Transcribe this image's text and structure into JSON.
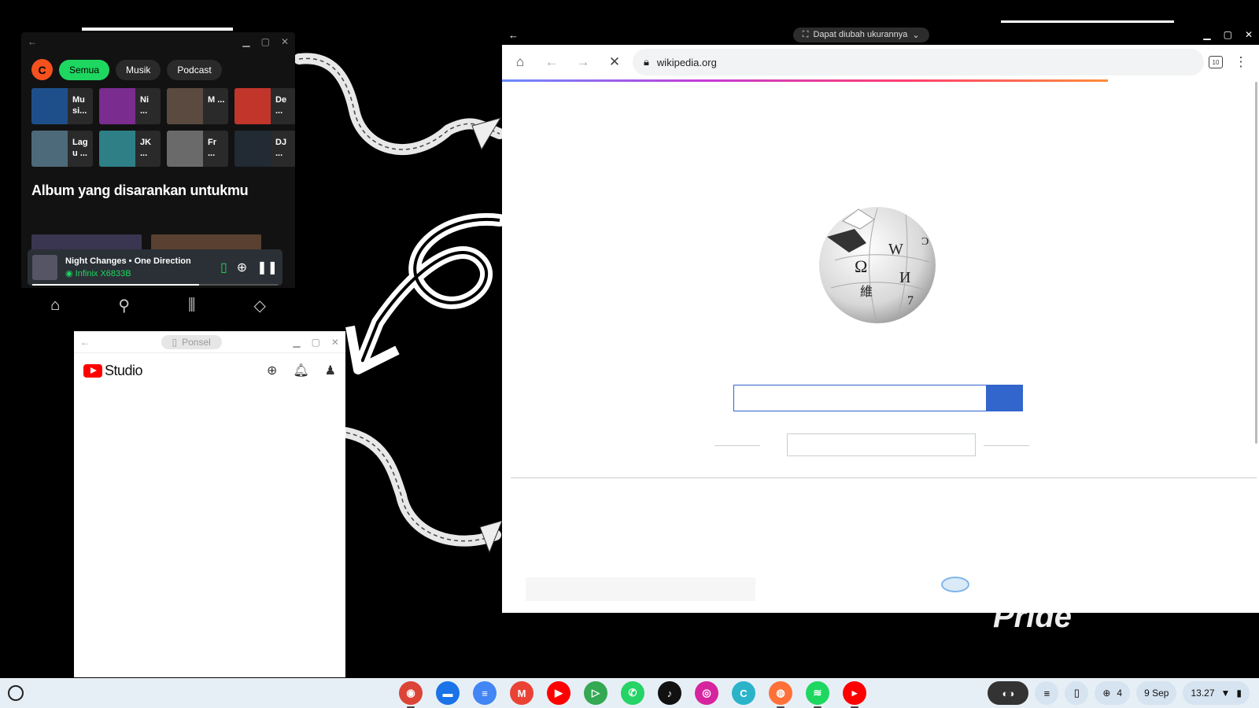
{
  "spotify": {
    "profile_initial": "C",
    "filters": [
      "Semua",
      "Musik",
      "Podcast"
    ],
    "tiles": [
      {
        "label": "Mu si...",
        "color": "#1e4f8a"
      },
      {
        "label": "Ni ...",
        "color": "#7a2c8f"
      },
      {
        "label": "M ...",
        "color": "#5b4a40"
      },
      {
        "label": "De ...",
        "color": "#c1352b"
      },
      {
        "label": "Lag u ...",
        "color": "#4d6a7a"
      },
      {
        "label": "JK ...",
        "color": "#2e7f86"
      },
      {
        "label": "Fr ...",
        "color": "#6a6a6a"
      },
      {
        "label": "DJ ...",
        "color": "#222a33"
      }
    ],
    "section_title": "Album yang disarankan untukmu",
    "now_playing": {
      "song": "Night Changes • One Direction",
      "device": "Infinix X6833B",
      "progress": 0.68
    }
  },
  "ytstudio": {
    "device_chip": "Ponsel",
    "logo_text": "Studio"
  },
  "chrome": {
    "resize_chip": "Dapat diubah ukurannya",
    "url": "wikipedia.org",
    "tab_count": "10",
    "load_progress": 0.8
  },
  "wallpaper": {
    "text": "Pride"
  },
  "shelf": {
    "apps": [
      {
        "name": "chrome-icon",
        "color": "#db4437",
        "glyph": "◉",
        "running": true
      },
      {
        "name": "files-icon",
        "color": "#1a73e8",
        "glyph": "▬",
        "running": false
      },
      {
        "name": "docs-icon",
        "color": "#4285f4",
        "glyph": "≡",
        "running": false
      },
      {
        "name": "gmail-icon",
        "color": "#ea4335",
        "glyph": "M",
        "running": false
      },
      {
        "name": "youtube-icon",
        "color": "#ff0000",
        "glyph": "▶",
        "running": false
      },
      {
        "name": "play-store-icon",
        "color": "#34a853",
        "glyph": "▷",
        "running": false
      },
      {
        "name": "whatsapp-icon",
        "color": "#25d366",
        "glyph": "✆",
        "running": false
      },
      {
        "name": "tiktok-icon",
        "color": "#111111",
        "glyph": "♪",
        "running": false
      },
      {
        "name": "instagram-icon",
        "color": "#d6249f",
        "glyph": "◎",
        "running": false
      },
      {
        "name": "canva-icon",
        "color": "#2bb3c9",
        "glyph": "C",
        "running": false
      },
      {
        "name": "firefox-icon",
        "color": "#ff7139",
        "glyph": "◍",
        "running": true
      },
      {
        "name": "spotify-icon",
        "color": "#1ed760",
        "glyph": "≋",
        "running": true
      },
      {
        "name": "youtube-studio-icon",
        "color": "#ff0000",
        "glyph": "▸",
        "running": true
      }
    ],
    "notif_count": "4",
    "date": "9 Sep",
    "time": "13.27"
  }
}
